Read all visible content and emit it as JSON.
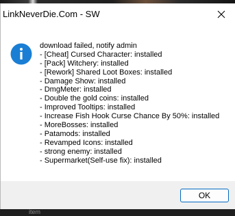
{
  "dialog": {
    "title": "LinkNeverDie.Com - SW",
    "icon": "info-icon",
    "accent_color": "#0067c0",
    "icon_color": "#1a7fd4",
    "message_lines": [
      "download failed, notify admin",
      "- [Cheat] Cursed Character: installed",
      "- [Pack] Witchery: installed",
      "- [Rework] Shared Loot Boxes: installed",
      "- Damage Show: installed",
      "- DmgMeter: installed",
      "- Double the gold coins: installed",
      "- Improved Tooltips: installed",
      "- Increase Fish Hook Curse Chance By 50%: installed",
      "- MoreBosses: installed",
      "- Patamods: installed",
      "- Revamped Icons: installed",
      "- strong enemy: installed",
      "- Supermarket(Self-use fix): installed"
    ],
    "ok_label": "OK"
  },
  "background": {
    "bottom_text": "item"
  }
}
